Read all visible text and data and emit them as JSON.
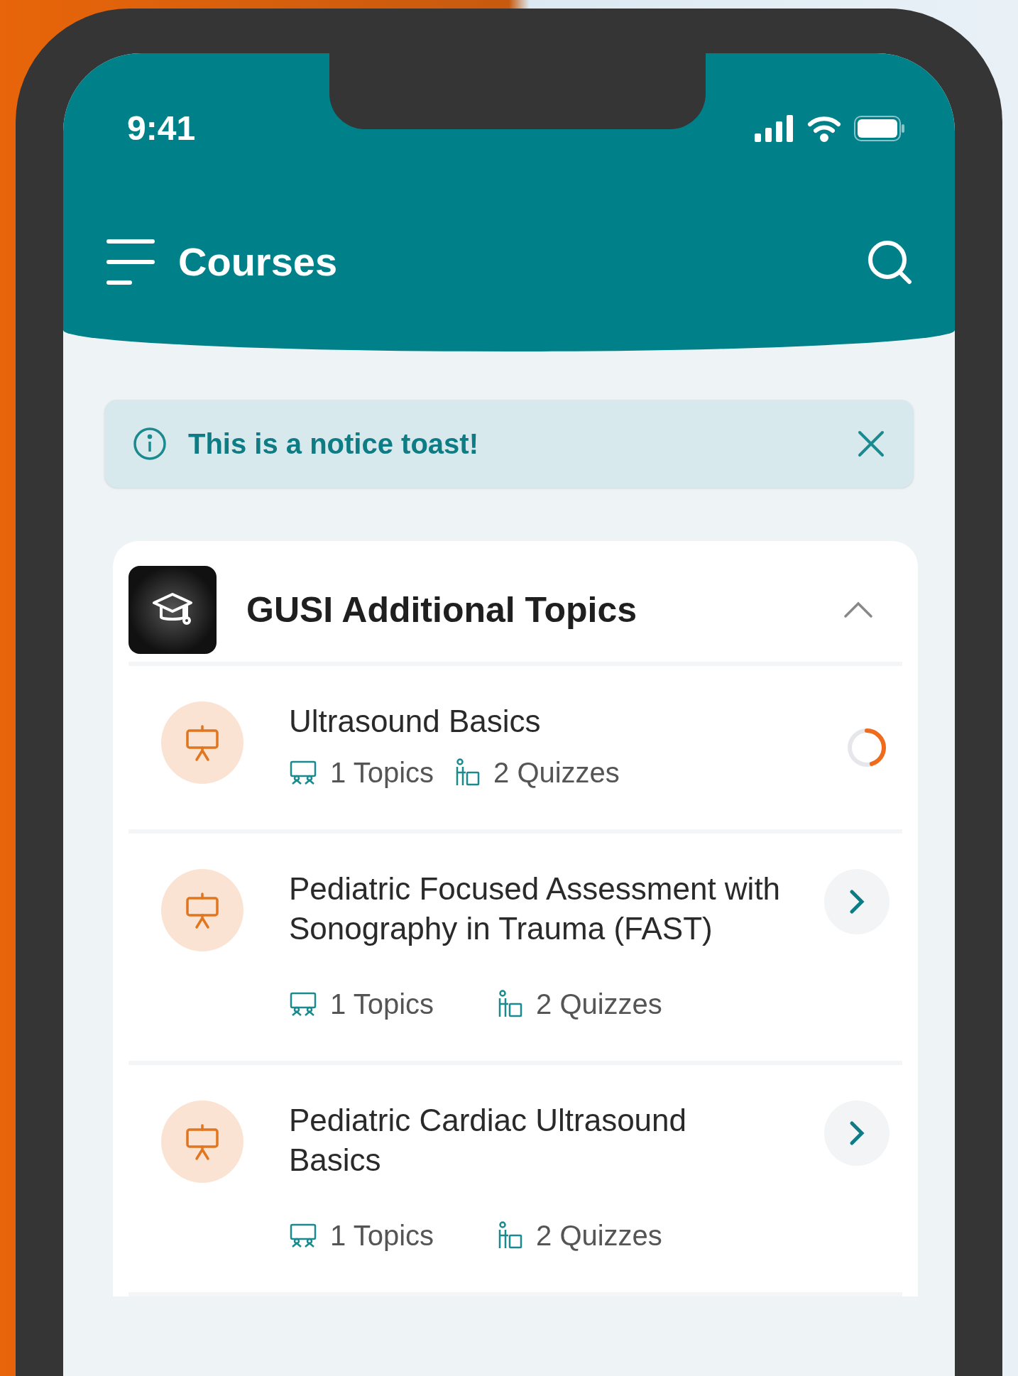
{
  "status_bar": {
    "time": "9:41"
  },
  "header": {
    "title": "Courses"
  },
  "toast": {
    "message": "This is a notice toast!"
  },
  "course_group": {
    "title": "GUSI Additional Topics",
    "expanded": true,
    "items": [
      {
        "kind": "progress",
        "title": "Ultrasound Basics",
        "topics": "1 Topics",
        "quizzes": "2 Quizzes",
        "level": 0.45
      },
      {
        "kind": "arrow",
        "title": "Pediatric Focused Assessment with Sonography in Trauma (FAST)",
        "topics": "1 Topics",
        "quizzes": "2 Quizzes"
      },
      {
        "kind": "arrow",
        "title": "Pediatric Cardiac Ultrasound Basics",
        "topics": "1 Topics",
        "quizzes": "2 Quizzes"
      }
    ]
  }
}
